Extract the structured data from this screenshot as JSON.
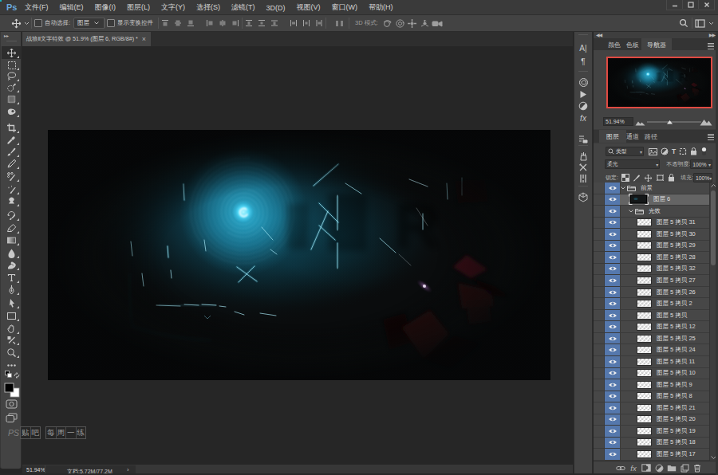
{
  "titlebar": {
    "logo": "Ps",
    "menus": [
      "文件(F)",
      "编辑(E)",
      "图像(I)",
      "图层(L)",
      "文字(Y)",
      "选择(S)",
      "滤镜(T)",
      "3D(D)",
      "视图(V)",
      "窗口(W)",
      "帮助(H)"
    ],
    "window_controls": {
      "minimize": "–",
      "maximize": "□",
      "close": "×"
    }
  },
  "options_bar": {
    "tool": "move-tool",
    "auto_select_label": "自动选择:",
    "auto_select_value": "图层",
    "show_transform_label": "显示变换控件",
    "mode_label": "3D 模式:"
  },
  "document_tab": {
    "title": "战狼Ⅱ文字特效 @ 51.9% (图层 6, RGB/8#) *",
    "close": "×"
  },
  "toolbar_tools": [
    "move",
    "rectangular-marquee",
    "lasso",
    "quick-selection",
    "magic-wand",
    "healing-brush",
    "crop",
    "eyedropper",
    "brush",
    "pencil",
    "color-replacement",
    "mixer-brush",
    "clone-stamp",
    "history-brush",
    "eraser",
    "gradient",
    "blur",
    "smudge",
    "type",
    "pen",
    "path-selection",
    "rectangle",
    "hand",
    "rotate-view",
    "zoom",
    "edit-toolbar"
  ],
  "navigator": {
    "tabs": [
      "颜色",
      "色板",
      "导航器"
    ],
    "active_tab": "导航器",
    "zoom_value": "51.94%"
  },
  "layers_panel": {
    "tabs": [
      "图层",
      "通道",
      "路径"
    ],
    "active_tab": "图层",
    "filter_label": "类型",
    "blend_mode": "柔光",
    "opacity_label": "不透明度:",
    "opacity_value": "100%",
    "lock_label": "锁定:",
    "fill_label": "填充:",
    "fill_value": "100%",
    "layers": [
      {
        "name": "前景",
        "type": "group",
        "indent": 0,
        "selected": false
      },
      {
        "name": "图层 6",
        "type": "image",
        "indent": 1,
        "selected": true
      },
      {
        "name": "光效",
        "type": "group",
        "indent": 1,
        "selected": false
      },
      {
        "name": "图层 5 拷贝 31",
        "type": "pixel",
        "indent": 2,
        "selected": false
      },
      {
        "name": "图层 5 拷贝 30",
        "type": "pixel",
        "indent": 2,
        "selected": false
      },
      {
        "name": "图层 5 拷贝 29",
        "type": "pixel",
        "indent": 2,
        "selected": false
      },
      {
        "name": "图层 5 拷贝 28",
        "type": "pixel",
        "indent": 2,
        "selected": false
      },
      {
        "name": "图层 5 拷贝 32",
        "type": "pixel",
        "indent": 2,
        "selected": false
      },
      {
        "name": "图层 5 拷贝 27",
        "type": "pixel",
        "indent": 2,
        "selected": false
      },
      {
        "name": "图层 5 拷贝 26",
        "type": "pixel",
        "indent": 2,
        "selected": false
      },
      {
        "name": "图层 5 拷贝 2",
        "type": "pixel",
        "indent": 2,
        "selected": false
      },
      {
        "name": "图层 5 拷贝",
        "type": "pixel",
        "indent": 2,
        "selected": false
      },
      {
        "name": "图层 5 拷贝 12",
        "type": "pixel",
        "indent": 2,
        "selected": false
      },
      {
        "name": "图层 5 拷贝 25",
        "type": "pixel",
        "indent": 2,
        "selected": false
      },
      {
        "name": "图层 5 拷贝 24",
        "type": "pixel",
        "indent": 2,
        "selected": false
      },
      {
        "name": "图层 5 拷贝 11",
        "type": "pixel",
        "indent": 2,
        "selected": false
      },
      {
        "name": "图层 5 拷贝 10",
        "type": "pixel",
        "indent": 2,
        "selected": false
      },
      {
        "name": "图层 5 拷贝 9",
        "type": "pixel",
        "indent": 2,
        "selected": false
      },
      {
        "name": "图层 5 拷贝 8",
        "type": "pixel",
        "indent": 2,
        "selected": false
      },
      {
        "name": "图层 5 拷贝 21",
        "type": "pixel",
        "indent": 2,
        "selected": false
      },
      {
        "name": "图层 5 拷贝 20",
        "type": "pixel",
        "indent": 2,
        "selected": false
      },
      {
        "name": "图层 5 拷贝 19",
        "type": "pixel",
        "indent": 2,
        "selected": false
      },
      {
        "name": "图层 5 拷贝 18",
        "type": "pixel",
        "indent": 2,
        "selected": false
      },
      {
        "name": "图层 5 拷贝 17",
        "type": "pixel",
        "indent": 2,
        "selected": false
      }
    ]
  },
  "status_bar": {
    "zoom": "51.94%",
    "doc_info": "文档:5.72M/77.2M"
  },
  "watermark": {
    "prefix": "PS",
    "part1": "贴吧",
    "part2": "每周一练"
  },
  "colors": {
    "accent_blue": "#5578ad",
    "navigator_border": "#e04a42",
    "ps_logo_blue": "#6fb1e8",
    "glow_cyan": "#35d8f0"
  }
}
